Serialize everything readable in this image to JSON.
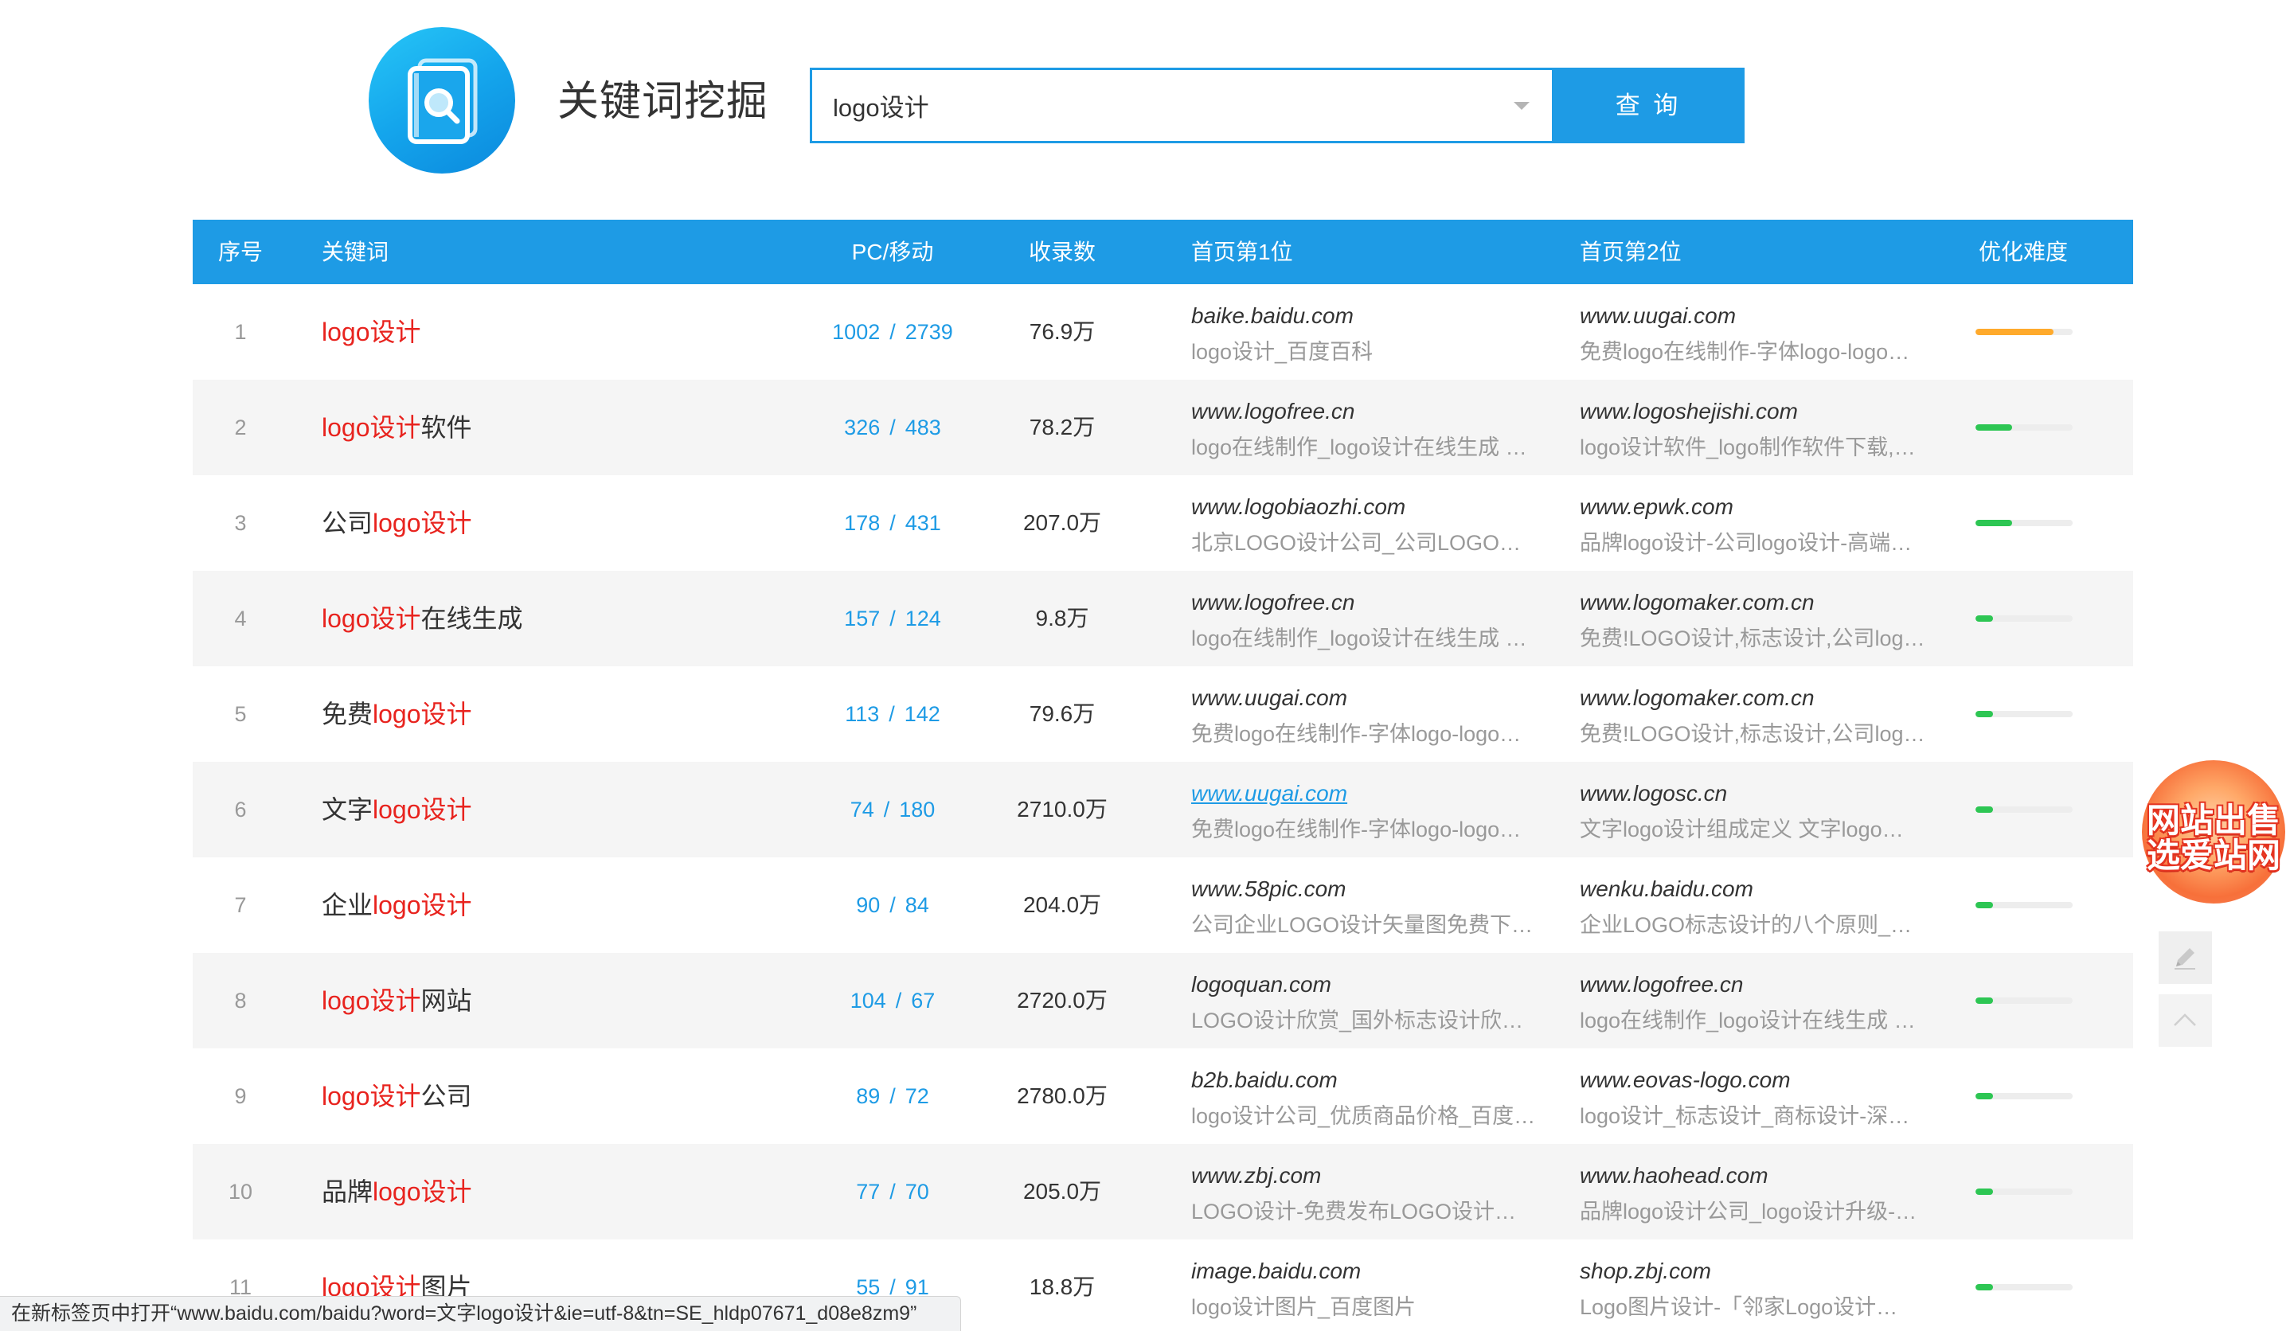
{
  "app": {
    "title": "关键词挖掘",
    "logo_icon": "document-search-icon"
  },
  "search": {
    "value": "logo设计",
    "dropdown_icon": "caret-down-icon",
    "button_label": "查 询"
  },
  "table": {
    "columns": {
      "index": "序号",
      "keyword": "关键词",
      "pc_mobile": "PC/移动",
      "indexed": "收录数",
      "rank1": "首页第1位",
      "rank2": "首页第2位",
      "difficulty": "优化难度"
    },
    "pc_mobile_separator": "/",
    "rows": [
      {
        "index": "1",
        "keyword": [
          {
            "text": "logo设计",
            "highlight": true
          }
        ],
        "pc": "1002",
        "mobile": "2739",
        "indexed": "76.9万",
        "site1": {
          "domain": "baike.baidu.com",
          "desc": "logo设计_百度百科"
        },
        "site2": {
          "domain": "www.uugai.com",
          "desc": "免费logo在线制作-字体logo-logo…"
        },
        "difficulty": 0.8,
        "difficulty_color": "#FFAA2C"
      },
      {
        "index": "2",
        "keyword": [
          {
            "text": "logo设计",
            "highlight": true
          },
          {
            "text": "软件",
            "highlight": false
          }
        ],
        "pc": "326",
        "mobile": "483",
        "indexed": "78.2万",
        "site1": {
          "domain": "www.logofree.cn",
          "desc": "logo在线制作_logo设计在线生成 …"
        },
        "site2": {
          "domain": "www.logoshejishi.com",
          "desc": "logo设计软件_logo制作软件下载,…"
        },
        "difficulty": 0.38,
        "difficulty_color": "#2DC653"
      },
      {
        "index": "3",
        "keyword": [
          {
            "text": "公司",
            "highlight": false
          },
          {
            "text": "logo设计",
            "highlight": true
          }
        ],
        "pc": "178",
        "mobile": "431",
        "indexed": "207.0万",
        "site1": {
          "domain": "www.logobiaozhi.com",
          "desc": "北京LOGO设计公司_公司LOGO…"
        },
        "site2": {
          "domain": "www.epwk.com",
          "desc": "品牌logo设计-公司logo设计-高端…"
        },
        "difficulty": 0.38,
        "difficulty_color": "#2DC653"
      },
      {
        "index": "4",
        "keyword": [
          {
            "text": "logo设计",
            "highlight": true
          },
          {
            "text": "在线生成",
            "highlight": false
          }
        ],
        "pc": "157",
        "mobile": "124",
        "indexed": "9.8万",
        "site1": {
          "domain": "www.logofree.cn",
          "desc": "logo在线制作_logo设计在线生成 …"
        },
        "site2": {
          "domain": "www.logomaker.com.cn",
          "desc": "免费!LOGO设计,标志设计,公司log…"
        },
        "difficulty": 0.18,
        "difficulty_color": "#2DC653"
      },
      {
        "index": "5",
        "keyword": [
          {
            "text": "免费",
            "highlight": false
          },
          {
            "text": "logo设计",
            "highlight": true
          }
        ],
        "pc": "113",
        "mobile": "142",
        "indexed": "79.6万",
        "site1": {
          "domain": "www.uugai.com",
          "desc": "免费logo在线制作-字体logo-logo…"
        },
        "site2": {
          "domain": "www.logomaker.com.cn",
          "desc": "免费!LOGO设计,标志设计,公司log…"
        },
        "difficulty": 0.18,
        "difficulty_color": "#2DC653"
      },
      {
        "index": "6",
        "keyword": [
          {
            "text": "文字",
            "highlight": false
          },
          {
            "text": "logo设计",
            "highlight": true
          }
        ],
        "pc": "74",
        "mobile": "180",
        "indexed": "2710.0万",
        "site1": {
          "domain": "www.uugai.com",
          "desc": "免费logo在线制作-字体logo-logo…",
          "hovered": true
        },
        "site2": {
          "domain": "www.logosc.cn",
          "desc": "文字logo设计组成定义 文字logo…"
        },
        "difficulty": 0.18,
        "difficulty_color": "#2DC653"
      },
      {
        "index": "7",
        "keyword": [
          {
            "text": "企业",
            "highlight": false
          },
          {
            "text": "logo设计",
            "highlight": true
          }
        ],
        "pc": "90",
        "mobile": "84",
        "indexed": "204.0万",
        "site1": {
          "domain": "www.58pic.com",
          "desc": "公司企业LOGO设计矢量图免费下…"
        },
        "site2": {
          "domain": "wenku.baidu.com",
          "desc": "企业LOGO标志设计的八个原则_…"
        },
        "difficulty": 0.18,
        "difficulty_color": "#2DC653"
      },
      {
        "index": "8",
        "keyword": [
          {
            "text": "logo设计",
            "highlight": true
          },
          {
            "text": "网站",
            "highlight": false
          }
        ],
        "pc": "104",
        "mobile": "67",
        "indexed": "2720.0万",
        "site1": {
          "domain": "logoquan.com",
          "desc": "LOGO设计欣赏_国外标志设计欣…"
        },
        "site2": {
          "domain": "www.logofree.cn",
          "desc": "logo在线制作_logo设计在线生成 …"
        },
        "difficulty": 0.18,
        "difficulty_color": "#2DC653"
      },
      {
        "index": "9",
        "keyword": [
          {
            "text": "logo设计",
            "highlight": true
          },
          {
            "text": "公司",
            "highlight": false
          }
        ],
        "pc": "89",
        "mobile": "72",
        "indexed": "2780.0万",
        "site1": {
          "domain": "b2b.baidu.com",
          "desc": "logo设计公司_优质商品价格_百度…"
        },
        "site2": {
          "domain": "www.eovas-logo.com",
          "desc": "logo设计_标志设计_商标设计-深…"
        },
        "difficulty": 0.18,
        "difficulty_color": "#2DC653"
      },
      {
        "index": "10",
        "keyword": [
          {
            "text": "品牌",
            "highlight": false
          },
          {
            "text": "logo设计",
            "highlight": true
          }
        ],
        "pc": "77",
        "mobile": "70",
        "indexed": "205.0万",
        "site1": {
          "domain": "www.zbj.com",
          "desc": "LOGO设计-免费发布LOGO设计…"
        },
        "site2": {
          "domain": "www.haohead.com",
          "desc": "品牌logo设计公司_logo设计升级-…"
        },
        "difficulty": 0.18,
        "difficulty_color": "#2DC653"
      },
      {
        "index": "11",
        "keyword": [
          {
            "text": "logo设计",
            "highlight": true
          },
          {
            "text": "图片",
            "highlight": false
          }
        ],
        "pc": "55",
        "mobile": "91",
        "indexed": "18.8万",
        "site1": {
          "domain": "image.baidu.com",
          "desc": "logo设计图片_百度图片"
        },
        "site2": {
          "domain": "shop.zbj.com",
          "desc": "Logo图片设计-「邻家Logo设计…"
        },
        "difficulty": 0.18,
        "difficulty_color": "#2DC653"
      }
    ]
  },
  "float": {
    "sale_badge": {
      "line1": "网站出售",
      "line2": "选爱站网"
    },
    "edit_icon": "pencil-icon",
    "top_icon": "chevron-up-icon"
  },
  "status_bar": {
    "text": "在新标签页中打开“www.baidu.com/baidu?word=文字logo设计&ie=utf-8&tn=SE_hldp07671_d08e8zm9”"
  },
  "colors": {
    "primary": "#1E9BE5",
    "keyword_highlight": "#E8231E",
    "difficulty_high": "#FFAA2C",
    "difficulty_low": "#2DC653"
  }
}
